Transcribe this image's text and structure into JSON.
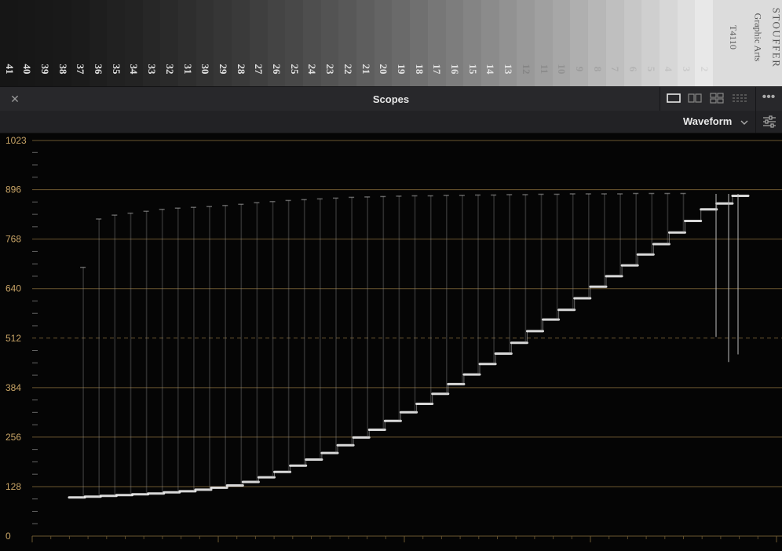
{
  "step_chart": {
    "step_numbers": [
      "41",
      "40",
      "39",
      "38",
      "37",
      "36",
      "35",
      "34",
      "33",
      "32",
      "31",
      "30",
      "29",
      "28",
      "27",
      "26",
      "25",
      "24",
      "23",
      "22",
      "21",
      "20",
      "19",
      "18",
      "17",
      "16",
      "15",
      "14",
      "13",
      "12",
      "11",
      "10",
      "9",
      "8",
      "7",
      "6",
      "5",
      "4",
      "3",
      "2"
    ],
    "brand_lines": [
      "STOUFFER",
      "Graphic Arts",
      "T4110"
    ]
  },
  "panel": {
    "title": "Scopes",
    "close_icon": "close-icon",
    "layout_icons": [
      "single-view-icon",
      "dual-view-icon",
      "quad-view-icon",
      "grid-view-icon"
    ],
    "more_icon": "more-icon"
  },
  "scope_toolbar": {
    "mode": "Waveform",
    "dropdown_icon": "chevron-down-icon",
    "settings_icon": "sliders-icon"
  },
  "colors": {
    "axis_label": "#c8a466",
    "gridline": "#6b5630",
    "trace": "#f0f0f0"
  },
  "chart_data": {
    "type": "line",
    "y_ticks": [
      "1023",
      "896",
      "768",
      "640",
      "512",
      "384",
      "256",
      "128",
      "0"
    ],
    "ylim": [
      0,
      1023
    ],
    "steps": [
      100,
      102,
      104,
      106,
      108,
      110,
      113,
      116,
      120,
      125,
      131,
      140,
      152,
      166,
      182,
      198,
      215,
      235,
      255,
      275,
      298,
      320,
      342,
      368,
      393,
      418,
      445,
      472,
      500,
      530,
      560,
      585,
      615,
      645,
      672,
      700,
      728,
      755,
      785,
      815,
      845,
      860,
      880
    ],
    "peak_levels": [
      695,
      820,
      830,
      835,
      840,
      845,
      848,
      850,
      852,
      855,
      858,
      862,
      865,
      868,
      870,
      872,
      874,
      876,
      877,
      878,
      879,
      880,
      880,
      881,
      881,
      882,
      882,
      883,
      883,
      884,
      884,
      885,
      885,
      885,
      885,
      886,
      886,
      886,
      886
    ]
  }
}
